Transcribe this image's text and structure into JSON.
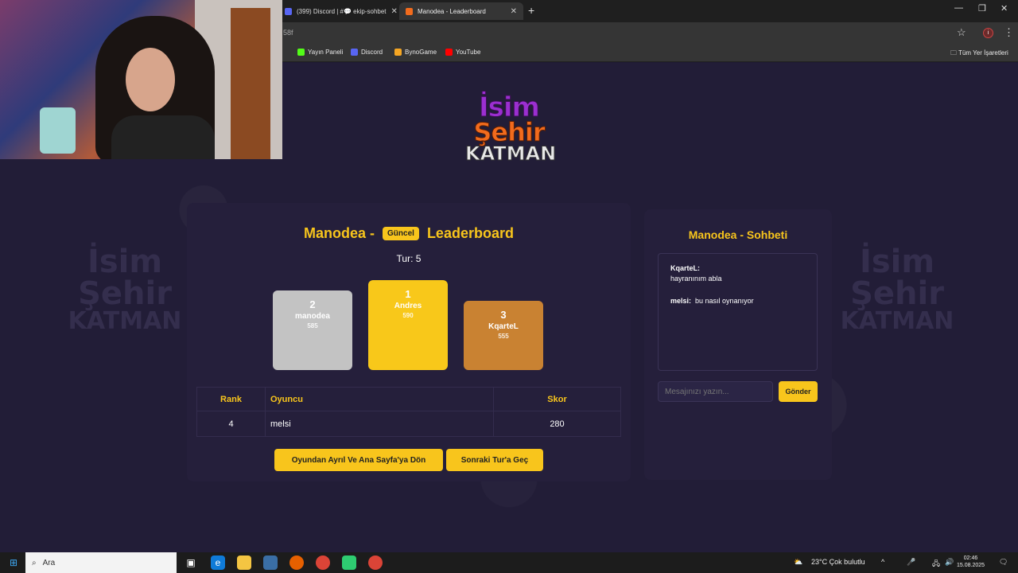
{
  "browser": {
    "tabs": [
      {
        "label": "(399) Discord | #💬 ekip-sohbet",
        "active": false
      },
      {
        "label": "Manodea - Leaderboard",
        "active": true
      }
    ],
    "url_fragment": "58f",
    "bookmarks": [
      "Yayın Paneli",
      "Discord",
      "BynoGame",
      "YouTube"
    ],
    "all_bookmarks": "Tüm Yer İşaretleri",
    "profile_letter": "i"
  },
  "logo": {
    "line1": "İsim",
    "line2": "Şehir",
    "line3": "KATMAN"
  },
  "leaderboard": {
    "title_left": "Manodea -",
    "badge": "Güncel",
    "title_right": "Leaderboard",
    "round": "Tur: 5",
    "podium": [
      {
        "rank": "2",
        "name": "manodea",
        "score": "585"
      },
      {
        "rank": "1",
        "name": "Andres",
        "score": "590"
      },
      {
        "rank": "3",
        "name": "KqarteL",
        "score": "555"
      }
    ],
    "headers": {
      "rank": "Rank",
      "player": "Oyuncu",
      "score": "Skor"
    },
    "rows": [
      {
        "rank": "4",
        "player": "melsi",
        "score": "280"
      }
    ],
    "leave_button": "Oyundan Ayrıl Ve Ana Sayfa'ya Dön",
    "next_button": "Sonraki Tur'a Geç"
  },
  "chat": {
    "title": "Manodea - Sohbeti",
    "messages": [
      {
        "user": "KqarteL:",
        "text": "hayranınım abla"
      },
      {
        "user": "melsi:",
        "text": "bu nasıl oynanıyor"
      }
    ],
    "placeholder": "Mesajınızı yazın...",
    "send": "Gönder"
  },
  "taskbar": {
    "search": "Ara",
    "weather": "23°C  Çok bulutlu",
    "time": "02:46",
    "date": "15.08.2025"
  },
  "colors": {
    "accent": "#f8c51c",
    "page_bg": "#221d37",
    "card_bg": "#251f3b"
  }
}
